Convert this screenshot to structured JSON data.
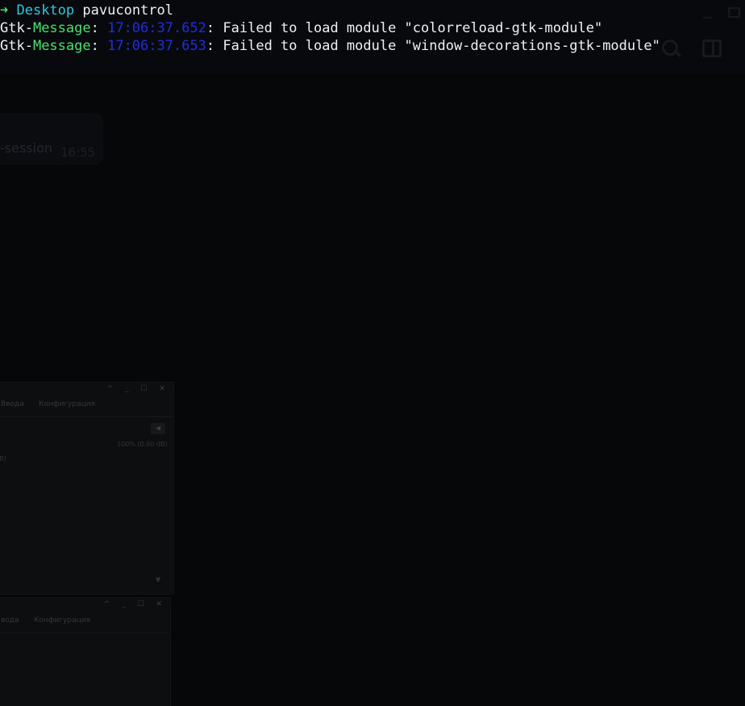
{
  "background_app": {
    "chat_item_name": "-session",
    "chat_item_time": "16:55"
  },
  "pavucontrol_window_1": {
    "tab_input": "Ввода",
    "tab_config": "Конфигурация",
    "volume_text": "100% (0,00 dB)",
    "partial_label": "B)",
    "title_buttons": "^ _ ☐ ✕"
  },
  "pavucontrol_window_2": {
    "tab_input": "вода",
    "tab_config": "Конфигурация",
    "title_buttons": "^ _ ☐ ✕"
  },
  "terminal": {
    "prompt": {
      "arrow": "➜",
      "directory": "Desktop",
      "command": "pavucontrol"
    },
    "messages": [
      {
        "prefix": "Gtk-",
        "kind": "Message",
        "time": "17:06:37.652",
        "text": ": Failed to load module \"colorreload-gtk-module\""
      },
      {
        "prefix": "Gtk-",
        "kind": "Message",
        "time": "17:06:37.653",
        "text": ": Failed to load module \"window-decorations-gtk-module\""
      }
    ]
  },
  "colors": {
    "background": "#060709",
    "prompt_arrow": "#43e36a",
    "directory": "#31c6d8",
    "message_kind": "#49e06b",
    "timestamp": "#1f2ed8",
    "text": "#eef0f2"
  }
}
